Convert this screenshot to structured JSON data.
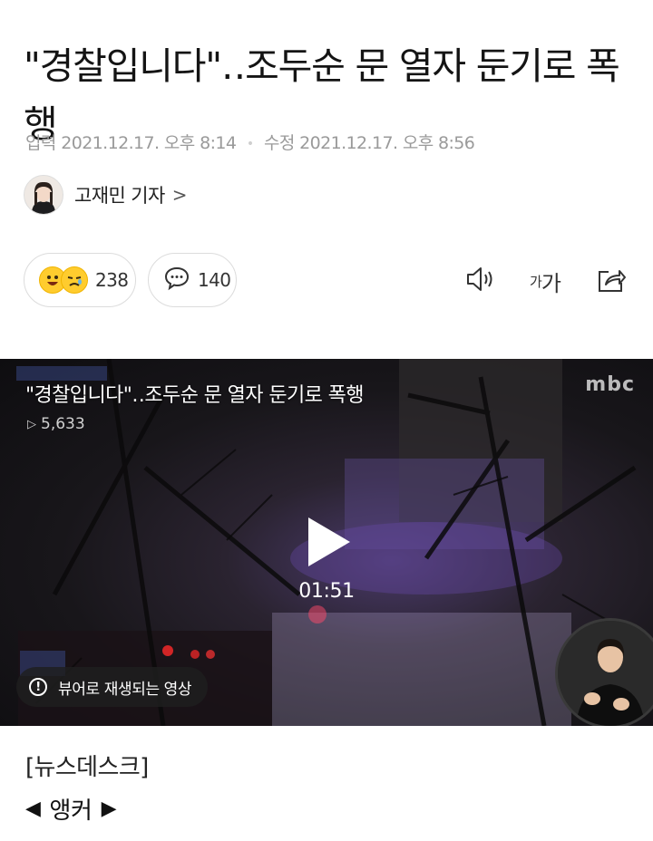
{
  "article": {
    "headline": "\"경찰입니다\"‥조두순 문 열자 둔기로 폭행",
    "input_label": "입력",
    "input_time": "2021.12.17. 오후 8:14",
    "modified_label": "수정",
    "modified_time": "2021.12.17. 오후 8:56",
    "reporter": "고재민 기자",
    "reporter_chevron": ">"
  },
  "actions": {
    "reaction_count": "238",
    "comment_count": "140",
    "font_label_small": "가",
    "font_label_large": "가"
  },
  "video": {
    "title": "\"경찰입니다\"‥조두순 문 열자 둔기로 폭행",
    "views": "5,633",
    "broadcaster": "MBC",
    "duration": "01:51",
    "viewer_notice": "뷰어로 재생되는 영상"
  },
  "body": {
    "section": "[뉴스데스크]",
    "anchor": "앵커"
  },
  "colors": {
    "emoji_yellow": "#ffcc2e",
    "meta_gray": "#9a9a9a",
    "border_gray": "#dcdcdc"
  },
  "icons": [
    "speaker-icon",
    "share-icon",
    "comment-icon",
    "play-icon",
    "info-icon"
  ]
}
